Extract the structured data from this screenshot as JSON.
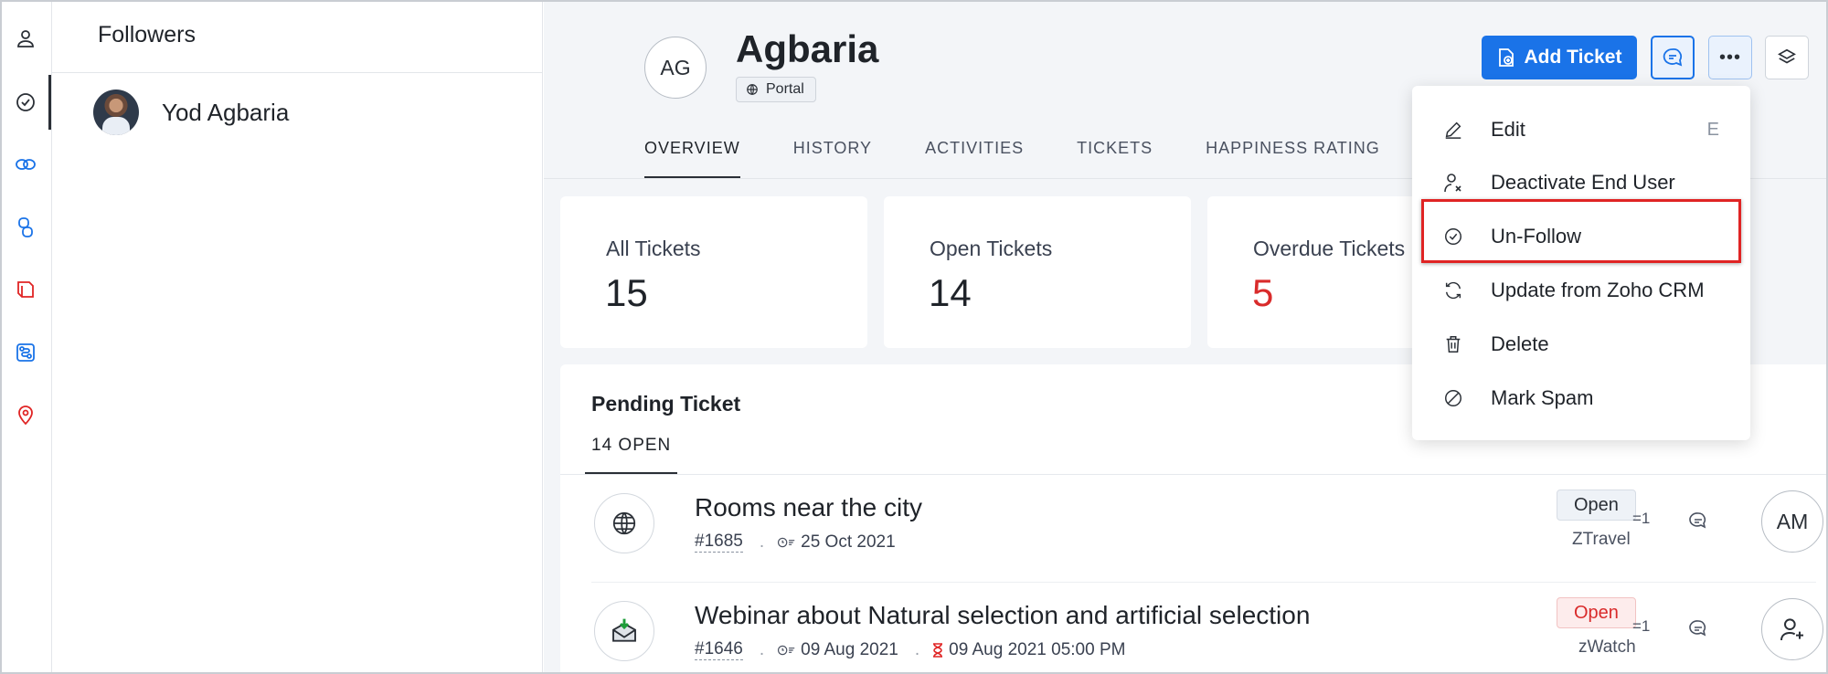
{
  "rail": {
    "icons": [
      "user-icon",
      "check-circle-icon",
      "link-icon",
      "group-icon",
      "book-icon",
      "route-icon",
      "location-pin-icon"
    ]
  },
  "followers": {
    "title": "Followers",
    "items": [
      {
        "name": "Yod Agbaria"
      }
    ]
  },
  "contact": {
    "initials": "AG",
    "name": "Agbaria",
    "badge": "Portal"
  },
  "tabs": [
    {
      "label": "OVERVIEW",
      "active": true
    },
    {
      "label": "HISTORY",
      "active": false
    },
    {
      "label": "ACTIVITIES",
      "active": false
    },
    {
      "label": "TICKETS",
      "active": false
    },
    {
      "label": "HAPPINESS RATING",
      "active": false
    }
  ],
  "toolbar": {
    "add_ticket_label": "Add Ticket",
    "more_label": "•••"
  },
  "stats": [
    {
      "label": "All Tickets",
      "value": "15"
    },
    {
      "label": "Open Tickets",
      "value": "14"
    },
    {
      "label": "Overdue Tickets",
      "value": "5"
    }
  ],
  "pending": {
    "title": "Pending Ticket",
    "tab_label": "14 OPEN",
    "tickets": [
      {
        "subject": "Rooms near the city",
        "number": "#1685",
        "date": "25 Oct 2021",
        "due": "",
        "status": "Open",
        "department": "ZTravel",
        "priority": "=1",
        "owner_initials": "AM"
      },
      {
        "subject": "Webinar about Natural selection and artificial selection",
        "number": "#1646",
        "date": "09 Aug 2021",
        "due": "09 Aug 2021 05:00 PM",
        "status": "Open",
        "department": "zWatch",
        "priority": "=1",
        "owner_initials": ""
      }
    ]
  },
  "menu": {
    "items": [
      {
        "label": "Edit",
        "shortcut": "E",
        "icon": "pencil-icon"
      },
      {
        "label": "Deactivate End User",
        "shortcut": "",
        "icon": "user-remove-icon"
      },
      {
        "label": "Un-Follow",
        "shortcut": "",
        "icon": "check-circle-icon"
      },
      {
        "label": "Update from Zoho CRM",
        "shortcut": "",
        "icon": "refresh-icon"
      },
      {
        "label": "Delete",
        "shortcut": "",
        "icon": "trash-icon"
      },
      {
        "label": "Mark Spam",
        "shortcut": "",
        "icon": "block-icon"
      }
    ],
    "highlighted_item": "Un-Follow"
  },
  "colors": {
    "accent": "#1a73e8",
    "overdue": "#d92b2b",
    "highlight": "#e02424"
  }
}
